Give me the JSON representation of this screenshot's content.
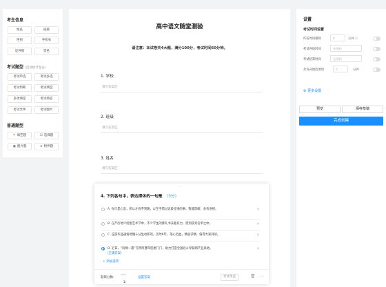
{
  "left_panel": {
    "candidate_section": {
      "title": "考生信息",
      "items": [
        "姓名",
        "班级",
        "性别",
        "手机号",
        "证件照",
        "签名"
      ]
    },
    "exam_section": {
      "title": "考试题型",
      "hint": "(自动统计总分)",
      "items": [
        "考试单选",
        "考试多选",
        "考试判断",
        "考试填空",
        "多项填空",
        "考试简答",
        "考试文件",
        "考试图片"
      ]
    },
    "general_section": {
      "title": "普通题型",
      "items": [
        {
          "icon": "edit-icon",
          "label": "填空题"
        },
        {
          "icon": "checkbox-icon",
          "label": "选择题"
        },
        {
          "icon": "image-icon",
          "label": "图片题"
        },
        {
          "icon": "attachment-icon",
          "label": "附件题"
        }
      ]
    }
  },
  "paper": {
    "title": "高中语文随堂测验",
    "note": "请注意：本试卷共4大题，满分100分，考试时间60分钟。",
    "questions": [
      {
        "label": "1. 学校",
        "placeholder": "请写答案区"
      },
      {
        "label": "2. 班级",
        "placeholder": "请写答案区"
      },
      {
        "label": "3. 姓名",
        "placeholder": "请写答案区"
      }
    ]
  },
  "question_card": {
    "title": "4. 下列各句中，表达得体的一句是",
    "score": "（3分）",
    "options": [
      {
        "text": "A. 你只是心急，所以才找不到路，以至于错过这段红线的事，我能理解，会有进把。",
        "selected": false
      },
      {
        "text": "B. 在严厉地介绍图艺术节中，不少学生的葬礼书法能有力，而到获奖名单之中。",
        "selected": false
      },
      {
        "text": "C. 这部作品通俗易懂十分生动新的，历时6年，笔心历血，精益求精，值得大家拜读。",
        "selected": false
      },
      {
        "text": "D. 近日，“同缘一著”元宵阿婆年您厘门门，助力打造全国北斗导联网产业高地。",
        "selected": true,
        "tag": "(正确答案)"
      }
    ],
    "add_option": "+ 添加选项",
    "footer": {
      "score_label": "题目分数:",
      "score_value": "3",
      "set_answer": "设置答案",
      "type_label": "考试单选",
      "delete_icon": "trash-icon",
      "more_icon": "more-icon"
    }
  },
  "settings": {
    "title": "设置",
    "subtitle": "考试时间设置",
    "rows": [
      {
        "label": "作答时间限制",
        "placeholder": "0",
        "unit": "分钟"
      },
      {
        "label": "考试开始时间",
        "placeholder": "无限制"
      },
      {
        "label": "考试结束时间",
        "placeholder": "无限制"
      },
      {
        "label": "允许开始后进场",
        "placeholder": "0",
        "unit": "分钟"
      }
    ],
    "more": "更多设置",
    "preview": "预览",
    "save_draft": "保存草稿",
    "finish": "完成创建",
    "accent": "#1890ff"
  }
}
